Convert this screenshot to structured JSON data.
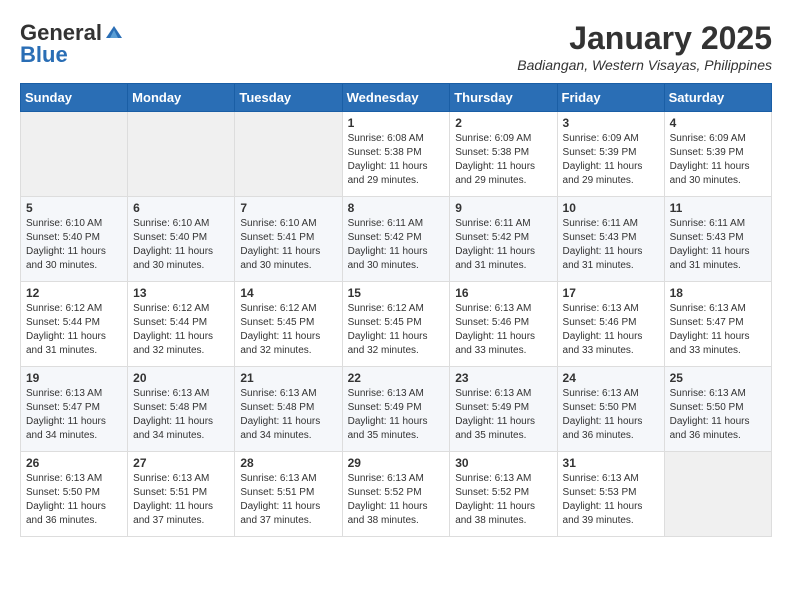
{
  "logo": {
    "general": "General",
    "blue": "Blue"
  },
  "title": {
    "month": "January 2025",
    "location": "Badiangan, Western Visayas, Philippines"
  },
  "days_header": [
    "Sunday",
    "Monday",
    "Tuesday",
    "Wednesday",
    "Thursday",
    "Friday",
    "Saturday"
  ],
  "weeks": [
    [
      {
        "day": "",
        "sunrise": "",
        "sunset": "",
        "daylight": ""
      },
      {
        "day": "",
        "sunrise": "",
        "sunset": "",
        "daylight": ""
      },
      {
        "day": "",
        "sunrise": "",
        "sunset": "",
        "daylight": ""
      },
      {
        "day": "1",
        "sunrise": "Sunrise: 6:08 AM",
        "sunset": "Sunset: 5:38 PM",
        "daylight": "Daylight: 11 hours and 29 minutes."
      },
      {
        "day": "2",
        "sunrise": "Sunrise: 6:09 AM",
        "sunset": "Sunset: 5:38 PM",
        "daylight": "Daylight: 11 hours and 29 minutes."
      },
      {
        "day": "3",
        "sunrise": "Sunrise: 6:09 AM",
        "sunset": "Sunset: 5:39 PM",
        "daylight": "Daylight: 11 hours and 29 minutes."
      },
      {
        "day": "4",
        "sunrise": "Sunrise: 6:09 AM",
        "sunset": "Sunset: 5:39 PM",
        "daylight": "Daylight: 11 hours and 30 minutes."
      }
    ],
    [
      {
        "day": "5",
        "sunrise": "Sunrise: 6:10 AM",
        "sunset": "Sunset: 5:40 PM",
        "daylight": "Daylight: 11 hours and 30 minutes."
      },
      {
        "day": "6",
        "sunrise": "Sunrise: 6:10 AM",
        "sunset": "Sunset: 5:40 PM",
        "daylight": "Daylight: 11 hours and 30 minutes."
      },
      {
        "day": "7",
        "sunrise": "Sunrise: 6:10 AM",
        "sunset": "Sunset: 5:41 PM",
        "daylight": "Daylight: 11 hours and 30 minutes."
      },
      {
        "day": "8",
        "sunrise": "Sunrise: 6:11 AM",
        "sunset": "Sunset: 5:42 PM",
        "daylight": "Daylight: 11 hours and 30 minutes."
      },
      {
        "day": "9",
        "sunrise": "Sunrise: 6:11 AM",
        "sunset": "Sunset: 5:42 PM",
        "daylight": "Daylight: 11 hours and 31 minutes."
      },
      {
        "day": "10",
        "sunrise": "Sunrise: 6:11 AM",
        "sunset": "Sunset: 5:43 PM",
        "daylight": "Daylight: 11 hours and 31 minutes."
      },
      {
        "day": "11",
        "sunrise": "Sunrise: 6:11 AM",
        "sunset": "Sunset: 5:43 PM",
        "daylight": "Daylight: 11 hours and 31 minutes."
      }
    ],
    [
      {
        "day": "12",
        "sunrise": "Sunrise: 6:12 AM",
        "sunset": "Sunset: 5:44 PM",
        "daylight": "Daylight: 11 hours and 31 minutes."
      },
      {
        "day": "13",
        "sunrise": "Sunrise: 6:12 AM",
        "sunset": "Sunset: 5:44 PM",
        "daylight": "Daylight: 11 hours and 32 minutes."
      },
      {
        "day": "14",
        "sunrise": "Sunrise: 6:12 AM",
        "sunset": "Sunset: 5:45 PM",
        "daylight": "Daylight: 11 hours and 32 minutes."
      },
      {
        "day": "15",
        "sunrise": "Sunrise: 6:12 AM",
        "sunset": "Sunset: 5:45 PM",
        "daylight": "Daylight: 11 hours and 32 minutes."
      },
      {
        "day": "16",
        "sunrise": "Sunrise: 6:13 AM",
        "sunset": "Sunset: 5:46 PM",
        "daylight": "Daylight: 11 hours and 33 minutes."
      },
      {
        "day": "17",
        "sunrise": "Sunrise: 6:13 AM",
        "sunset": "Sunset: 5:46 PM",
        "daylight": "Daylight: 11 hours and 33 minutes."
      },
      {
        "day": "18",
        "sunrise": "Sunrise: 6:13 AM",
        "sunset": "Sunset: 5:47 PM",
        "daylight": "Daylight: 11 hours and 33 minutes."
      }
    ],
    [
      {
        "day": "19",
        "sunrise": "Sunrise: 6:13 AM",
        "sunset": "Sunset: 5:47 PM",
        "daylight": "Daylight: 11 hours and 34 minutes."
      },
      {
        "day": "20",
        "sunrise": "Sunrise: 6:13 AM",
        "sunset": "Sunset: 5:48 PM",
        "daylight": "Daylight: 11 hours and 34 minutes."
      },
      {
        "day": "21",
        "sunrise": "Sunrise: 6:13 AM",
        "sunset": "Sunset: 5:48 PM",
        "daylight": "Daylight: 11 hours and 34 minutes."
      },
      {
        "day": "22",
        "sunrise": "Sunrise: 6:13 AM",
        "sunset": "Sunset: 5:49 PM",
        "daylight": "Daylight: 11 hours and 35 minutes."
      },
      {
        "day": "23",
        "sunrise": "Sunrise: 6:13 AM",
        "sunset": "Sunset: 5:49 PM",
        "daylight": "Daylight: 11 hours and 35 minutes."
      },
      {
        "day": "24",
        "sunrise": "Sunrise: 6:13 AM",
        "sunset": "Sunset: 5:50 PM",
        "daylight": "Daylight: 11 hours and 36 minutes."
      },
      {
        "day": "25",
        "sunrise": "Sunrise: 6:13 AM",
        "sunset": "Sunset: 5:50 PM",
        "daylight": "Daylight: 11 hours and 36 minutes."
      }
    ],
    [
      {
        "day": "26",
        "sunrise": "Sunrise: 6:13 AM",
        "sunset": "Sunset: 5:50 PM",
        "daylight": "Daylight: 11 hours and 36 minutes."
      },
      {
        "day": "27",
        "sunrise": "Sunrise: 6:13 AM",
        "sunset": "Sunset: 5:51 PM",
        "daylight": "Daylight: 11 hours and 37 minutes."
      },
      {
        "day": "28",
        "sunrise": "Sunrise: 6:13 AM",
        "sunset": "Sunset: 5:51 PM",
        "daylight": "Daylight: 11 hours and 37 minutes."
      },
      {
        "day": "29",
        "sunrise": "Sunrise: 6:13 AM",
        "sunset": "Sunset: 5:52 PM",
        "daylight": "Daylight: 11 hours and 38 minutes."
      },
      {
        "day": "30",
        "sunrise": "Sunrise: 6:13 AM",
        "sunset": "Sunset: 5:52 PM",
        "daylight": "Daylight: 11 hours and 38 minutes."
      },
      {
        "day": "31",
        "sunrise": "Sunrise: 6:13 AM",
        "sunset": "Sunset: 5:53 PM",
        "daylight": "Daylight: 11 hours and 39 minutes."
      },
      {
        "day": "",
        "sunrise": "",
        "sunset": "",
        "daylight": ""
      }
    ]
  ]
}
